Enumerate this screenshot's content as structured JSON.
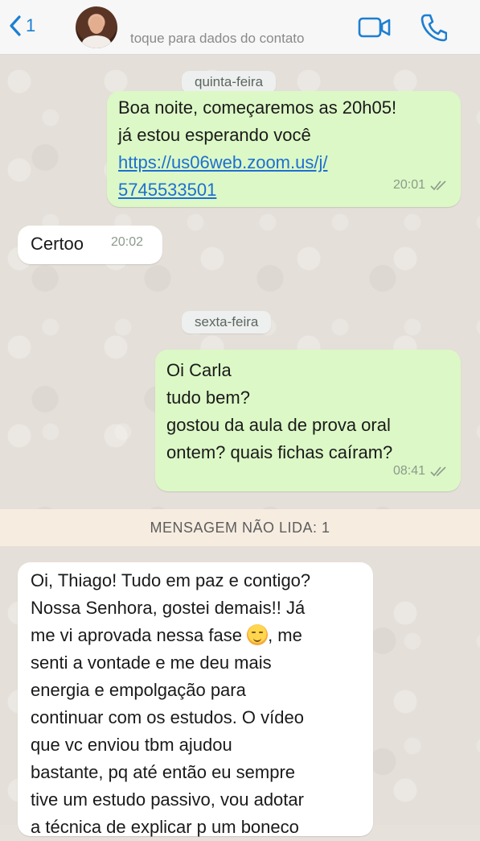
{
  "header": {
    "back_count": "1",
    "contact_hint": "toque para dados do contato"
  },
  "dates": {
    "first": "quinta-feira",
    "second": "sexta-feira"
  },
  "messages": [
    {
      "lines": [
        "Boa noite, começaremos as 20h05!",
        "já estou esperando você"
      ],
      "link_lines": [
        "https://us06web.zoom.us/j/",
        "5745533501"
      ],
      "time": "20:01"
    },
    {
      "lines": [
        "Certoo"
      ],
      "time": "20:02"
    },
    {
      "lines": [
        "Oi Carla",
        "tudo bem?",
        "gostou da aula de prova oral",
        "ontem? quais fichas caíram?"
      ],
      "time": "08:41"
    },
    {
      "lines": [
        "Oi, Thiago! Tudo em paz e contigo?",
        "Nossa Senhora, gostei demais!! Já",
        "me vi aprovada nessa fase",
        ", me",
        "senti a vontade e me deu mais",
        "energia e empolgação para",
        "continuar com os estudos. O vídeo",
        "que vc enviou tbm ajudou",
        "bastante, pq até então eu sempre",
        "tive um estudo passivo, vou adotar",
        "a técnica de explicar p um boneco"
      ],
      "emoji": "smiling-face-emoji"
    }
  ],
  "unread_label": "MENSAGEM NÃO LIDA: 1",
  "colors": {
    "accent": "#1d7fd1",
    "outgoing": "#dcf8c6",
    "incoming": "#ffffff",
    "unread_bar": "#f6ece0"
  },
  "icons": [
    "chevron-left-icon",
    "video-camera-icon",
    "phone-icon",
    "double-check-icon"
  ]
}
